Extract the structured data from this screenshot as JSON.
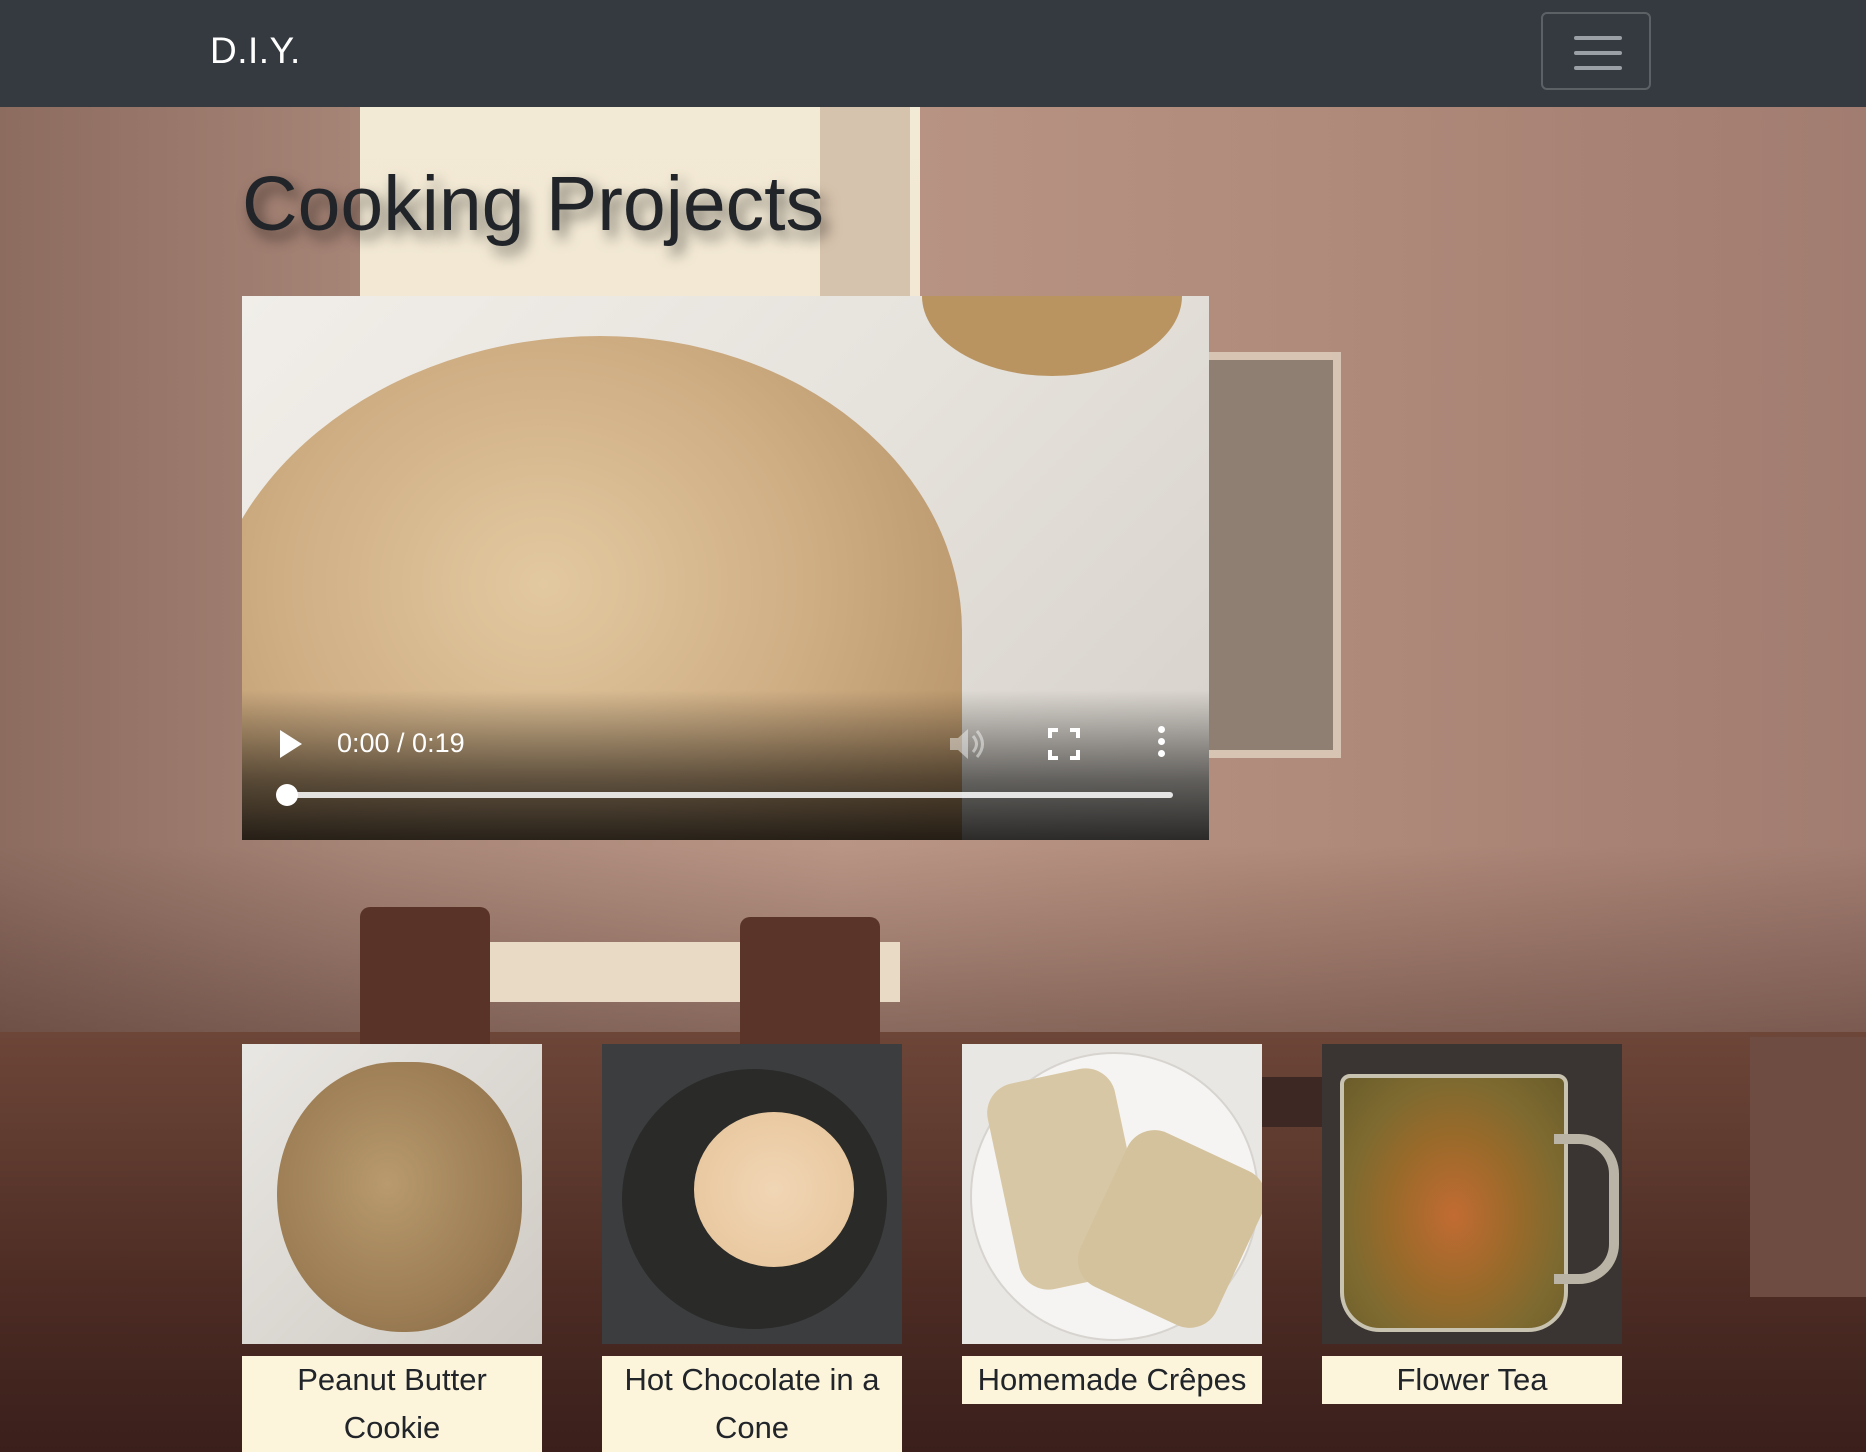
{
  "navbar": {
    "brand": "D.I.Y.",
    "toggle_icon": "hamburger-menu-icon"
  },
  "page": {
    "title": "Cooking Projects"
  },
  "video": {
    "time_display": "0:00 / 0:19",
    "progress": 0,
    "icons": [
      "play-icon",
      "volume-icon",
      "fullscreen-icon",
      "more-options-icon"
    ]
  },
  "projects": [
    {
      "caption": "Peanut Butter Cookie"
    },
    {
      "caption": "Hot Chocolate in a Cone"
    },
    {
      "caption": "Homemade Crêpes"
    },
    {
      "caption": "Flower Tea"
    }
  ],
  "colors": {
    "navbar_bg": "#343a40",
    "caption_bg": "#fcf5dc",
    "title_text": "#212529"
  }
}
